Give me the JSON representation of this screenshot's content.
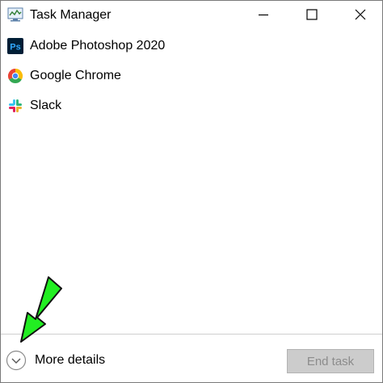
{
  "window": {
    "title": "Task Manager",
    "title_icon": "task-manager-icon",
    "controls": [
      "minimize-icon",
      "maximize-icon",
      "close-icon"
    ]
  },
  "tasks": [
    {
      "label": "Adobe Photoshop 2020",
      "icon": "photoshop-icon",
      "icon_text": "Ps"
    },
    {
      "label": "Google Chrome",
      "icon": "chrome-icon"
    },
    {
      "label": "Slack",
      "icon": "slack-icon"
    }
  ],
  "footer": {
    "more_details_label": "More details",
    "more_details_icon": "chevron-down-circle-icon",
    "end_task_label": "End task",
    "end_task_enabled": false
  },
  "annotation": {
    "arrow_icon": "green-arrow-icon",
    "arrow_color": "#22ee22"
  },
  "colors": {
    "photoshop_bg": "#001e36",
    "photoshop_fg": "#31a8ff",
    "disabled_button_bg": "#cccccc",
    "disabled_button_text": "#8c8c8c"
  }
}
